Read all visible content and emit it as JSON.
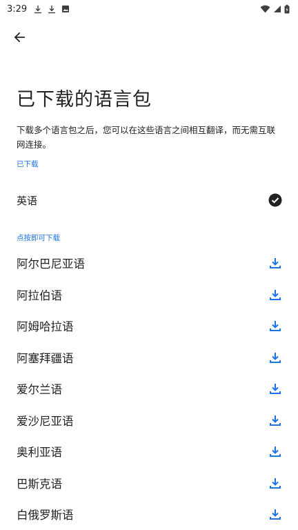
{
  "status_bar": {
    "time": "3:29"
  },
  "page": {
    "title": "已下载的语言包",
    "description": "下载多个语言包之后，您可以在这些语言之间相互翻译，而无需互联网连接。"
  },
  "downloaded_section": {
    "header": "已下载",
    "items": [
      {
        "label": "英语",
        "icon": "check-circle-icon"
      }
    ]
  },
  "available_section": {
    "header": "点按即可下载",
    "items": [
      {
        "label": "阿尔巴尼亚语",
        "icon": "download-icon"
      },
      {
        "label": "阿拉伯语",
        "icon": "download-icon"
      },
      {
        "label": "阿姆哈拉语",
        "icon": "download-icon"
      },
      {
        "label": "阿塞拜疆语",
        "icon": "download-icon"
      },
      {
        "label": "爱尔兰语",
        "icon": "download-icon"
      },
      {
        "label": "爱沙尼亚语",
        "icon": "download-icon"
      },
      {
        "label": "奥利亚语",
        "icon": "download-icon"
      },
      {
        "label": "巴斯克语",
        "icon": "download-icon"
      },
      {
        "label": "白俄罗斯语",
        "icon": "download-icon"
      }
    ]
  },
  "colors": {
    "accent": "#1a73e8",
    "text": "#202124"
  }
}
